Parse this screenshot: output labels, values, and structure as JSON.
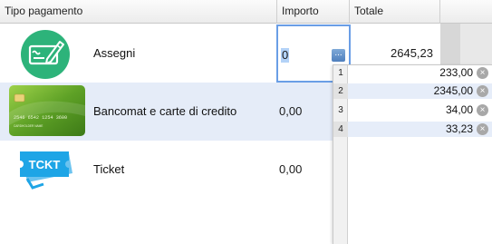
{
  "header": {
    "col_tipo": "Tipo pagamento",
    "col_importo": "Importo",
    "col_totale": "Totale"
  },
  "rows": [
    {
      "label": "Assegni",
      "importo": "",
      "totale": "2645,23",
      "icon": "cheque-icon"
    },
    {
      "label": "Bancomat e carte di credito",
      "importo": "0,00",
      "totale": "",
      "icon": "credit-card-icon"
    },
    {
      "label": "Ticket",
      "importo": "0,00",
      "totale": "",
      "icon": "ticket-icon"
    }
  ],
  "edit_field": {
    "value": "0",
    "button_label": "..."
  },
  "card": {
    "number": "2546 6542 1254 3600",
    "holder": "CARDHOLDER NAME"
  },
  "ticket_text": "TCKT",
  "popup": {
    "items": [
      {
        "index": "1",
        "value": "233,00"
      },
      {
        "index": "2",
        "value": "2345,00"
      },
      {
        "index": "3",
        "value": "34,00"
      },
      {
        "index": "4",
        "value": "33,23"
      }
    ],
    "remove_glyph": "×"
  },
  "colors": {
    "selection_row": "#e5ecf8",
    "focus_border": "#6a9ee6",
    "cheque_green": "#2db37a",
    "card_green": "#6fae2c",
    "ticket_blue": "#1ea5e6"
  }
}
